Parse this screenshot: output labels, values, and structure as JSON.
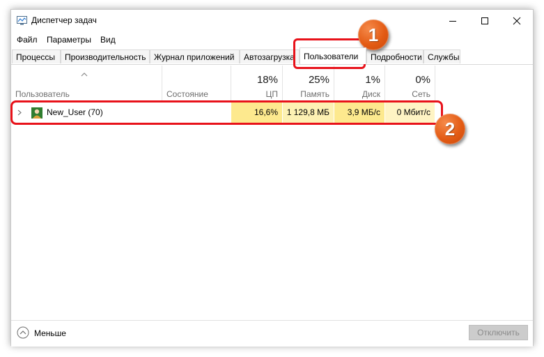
{
  "window": {
    "title": "Диспетчер задач"
  },
  "menu": [
    "Файл",
    "Параметры",
    "Вид"
  ],
  "tabs": [
    {
      "label": "Процессы"
    },
    {
      "label": "Производительность"
    },
    {
      "label": "Журнал приложений"
    },
    {
      "label": "Автозагрузка"
    },
    {
      "label": "Пользователи"
    },
    {
      "label": "Подробности"
    },
    {
      "label": "Службы"
    }
  ],
  "active_tab": "Пользователи",
  "columns": {
    "user": {
      "label": "Пользователь"
    },
    "status": {
      "label": "Состояние"
    },
    "cpu": {
      "percent": "18%",
      "label": "ЦП"
    },
    "memory": {
      "percent": "25%",
      "label": "Память"
    },
    "disk": {
      "percent": "1%",
      "label": "Диск"
    },
    "network": {
      "percent": "0%",
      "label": "Сеть"
    }
  },
  "users": [
    {
      "name": "New_User (70)",
      "cpu": "16,6%",
      "memory": "1 129,8 МБ",
      "disk": "3,9 МБ/с",
      "network": "0 Мбит/с"
    }
  ],
  "footer": {
    "less_label": "Меньше",
    "disconnect_label": "Отключить"
  },
  "annotations": [
    "1",
    "2"
  ],
  "colors": {
    "highlight": "#e8121a",
    "badge": "#e35b14",
    "cell_cpu": "#fde98e",
    "cell_memory": "#fdf1b3",
    "cell_disk": "#fde98e",
    "cell_network": "#fff4c4"
  }
}
